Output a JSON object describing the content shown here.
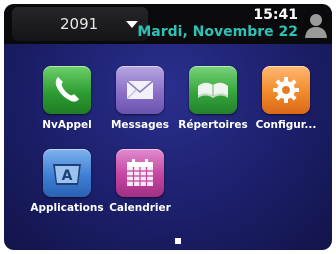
{
  "header": {
    "line_number": "2091",
    "time": "15:41",
    "date": "Mardi, Novembre 22"
  },
  "apps": [
    {
      "label": "NvAppel",
      "icon": "phone-icon",
      "color": "#2e9d33"
    },
    {
      "label": "Messages",
      "icon": "envelope-icon",
      "color": "#8a6fc8"
    },
    {
      "label": "Répertoires",
      "icon": "open-book-icon",
      "color": "#35a63c"
    },
    {
      "label": "Configur...",
      "icon": "gear-icon",
      "color": "#f28a2a"
    },
    {
      "label": "Applications",
      "icon": "applications-icon",
      "color": "#3f7fd4"
    },
    {
      "label": "Calendrier",
      "icon": "calendar-icon",
      "color": "#c4459f"
    }
  ],
  "pager": {
    "current_page": 1
  }
}
